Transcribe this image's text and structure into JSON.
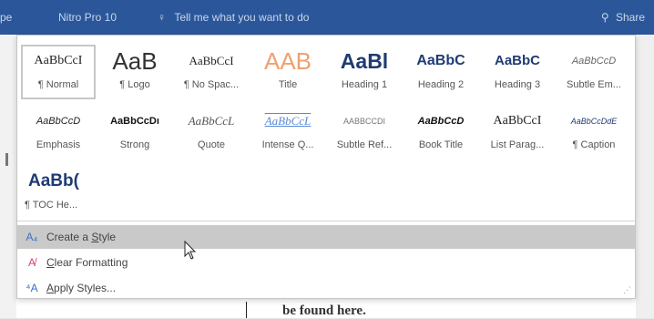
{
  "ribbon": {
    "tab_left": "pe",
    "font_box": "Nitro Pro 10",
    "tell_me": "Tell me what you want to do",
    "share": "Share",
    "colors": {
      "ribbon_bg": "#2b579a"
    }
  },
  "document": {
    "visible_text": "be found here."
  },
  "gallery": {
    "rows": [
      [
        {
          "name": "¶ Normal",
          "preview": "AaBbCcI",
          "selected": true
        },
        {
          "name": "¶ Logo",
          "preview": "AaB"
        },
        {
          "name": "¶ No Spac...",
          "preview": "AaBbCcI"
        },
        {
          "name": "Title",
          "preview": "AAB"
        },
        {
          "name": "Heading 1",
          "preview": "AaBl"
        },
        {
          "name": "Heading 2",
          "preview": "AaBbC"
        },
        {
          "name": "Heading 3",
          "preview": "AaBbC"
        },
        {
          "name": "Subtle Em...",
          "preview": "AaBbCcD"
        }
      ],
      [
        {
          "name": "Emphasis",
          "preview": "AaBbCcD"
        },
        {
          "name": "Strong",
          "preview": "AaBbCcDı"
        },
        {
          "name": "Quote",
          "preview": "AaBbCcL"
        },
        {
          "name": "Intense Q...",
          "preview": "AaBbCcL"
        },
        {
          "name": "Subtle Ref...",
          "preview": "AABBCCDI"
        },
        {
          "name": "Book Title",
          "preview": "AaBbCcD"
        },
        {
          "name": "List Parag...",
          "preview": "AaBbCcI"
        },
        {
          "name": "¶ Caption",
          "preview": "AaBbCcDdE"
        }
      ],
      [
        {
          "name": "¶ TOC He...",
          "preview": "AaBb("
        }
      ]
    ],
    "commands": [
      {
        "icon": "create-style-icon",
        "label_pre": "Create a ",
        "label_key": "S",
        "label_post": "tyle",
        "hover": true
      },
      {
        "icon": "clear-formatting-icon",
        "label_pre": "",
        "label_key": "C",
        "label_post": "lear Formatting"
      },
      {
        "icon": "apply-styles-icon",
        "label_pre": "",
        "label_key": "A",
        "label_post": "pply Styles..."
      }
    ]
  }
}
